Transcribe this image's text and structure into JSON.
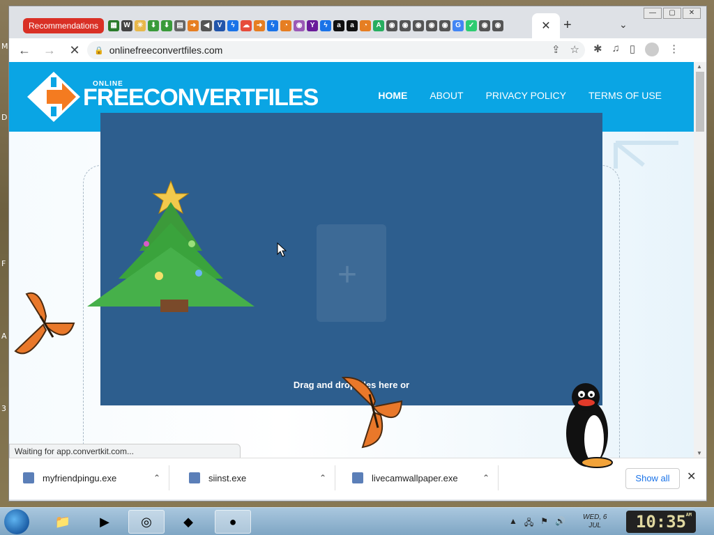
{
  "desktop": {
    "letters": [
      "M",
      "D",
      "F",
      "A",
      "3"
    ]
  },
  "window": {
    "controls": [
      "—",
      "▢",
      "✕"
    ]
  },
  "tabs": {
    "recommendations_label": "Recommendations",
    "tab_icon_glyphs": [
      "▦",
      "W",
      "✳",
      "⬇",
      "⬇",
      "▤",
      "➜",
      "◀",
      "V",
      "ϟ",
      "☁",
      "➜",
      "ϟ",
      "◔",
      "◉",
      "Y",
      "ϟ",
      "a",
      "a",
      "◔",
      "A",
      "◉",
      "◉",
      "◉",
      "◉",
      "◉",
      "G",
      "✓",
      "◉",
      "◉"
    ],
    "active_close": "✕",
    "new_tab": "+",
    "menu": "⌄"
  },
  "toolbar": {
    "back": "←",
    "forward": "→",
    "stop": "✕",
    "url": "onlinefreeconvertfiles.com",
    "share_icon": "⇪",
    "star_icon": "☆",
    "ext_icon": "✱",
    "media_icon": "♫",
    "sidepanel_icon": "▯",
    "menu_icon": "⋮"
  },
  "site": {
    "logo_small": "ONLINE",
    "logo_text": "FREECONVERTFILES",
    "nav": [
      {
        "label": "HOME",
        "active": true
      },
      {
        "label": "ABOUT",
        "active": false
      },
      {
        "label": "PRIVACY POLICY",
        "active": false
      },
      {
        "label": "TERMS OF USE",
        "active": false
      }
    ],
    "drop_text": "Drag and drop files here or"
  },
  "status": {
    "text": "Waiting for app.convertkit.com..."
  },
  "downloads": {
    "items": [
      {
        "name": "myfriendpingu.exe"
      },
      {
        "name": "siinst.exe"
      },
      {
        "name": "livecamwallpaper.exe"
      }
    ],
    "show_all": "Show all",
    "close": "✕",
    "chevron": "⌃"
  },
  "taskbar": {
    "apps": [
      "📁",
      "▶",
      "◎",
      "◆",
      "●"
    ],
    "date_line1": "WED, 6",
    "date_line2": "JUL",
    "time": "10:35",
    "ampm": "AM"
  },
  "colors": {
    "header_blue": "#0aa5e4",
    "drop_zone": "#2d5e8e",
    "logo_orange": "#f47b20",
    "rec_red": "#d93025"
  }
}
